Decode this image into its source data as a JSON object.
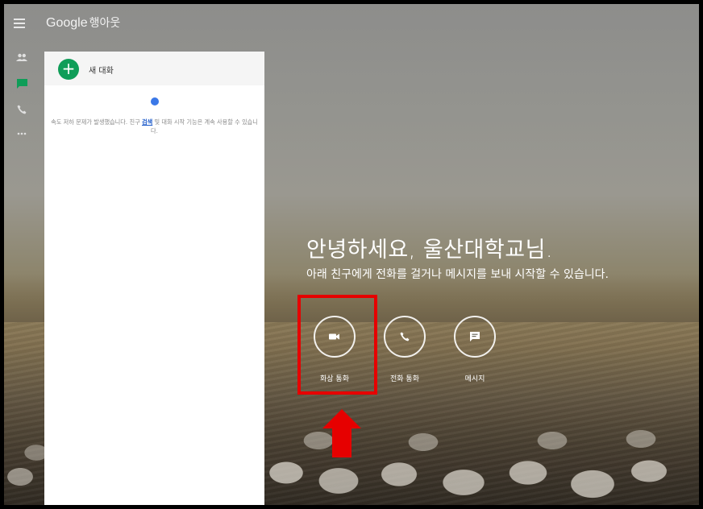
{
  "app": {
    "brand_google": "Google",
    "brand_name": "행아웃"
  },
  "rail": {
    "items": [
      {
        "name": "contacts-icon",
        "color": "#e0e0e0"
      },
      {
        "name": "chat-icon",
        "color": "#0f9d58"
      },
      {
        "name": "phone-icon",
        "color": "#e0e0e0"
      },
      {
        "name": "more-icon",
        "color": "#e0e0e0"
      }
    ]
  },
  "panel": {
    "new_conversation_label": "새 대화",
    "warning_before": "속도 저하 문제가 발생했습니다. 친구 ",
    "warning_link": "검색",
    "warning_after": " 및 대화 시작 기능은 계속 사용할 수 있습니다."
  },
  "main": {
    "greeting": "안녕하세요, 울산대학교님.",
    "subtitle": "아래 친구에게 전화를 걸거나 메시지를 보내 시작할 수 있습니다.",
    "actions": [
      {
        "label": "화상 통화",
        "icon": "video-icon"
      },
      {
        "label": "전화 통화",
        "icon": "phone-icon"
      },
      {
        "label": "메시지",
        "icon": "message-icon"
      }
    ]
  },
  "annotation": {
    "highlight_color": "#e60000",
    "arrow_color": "#e60000"
  }
}
